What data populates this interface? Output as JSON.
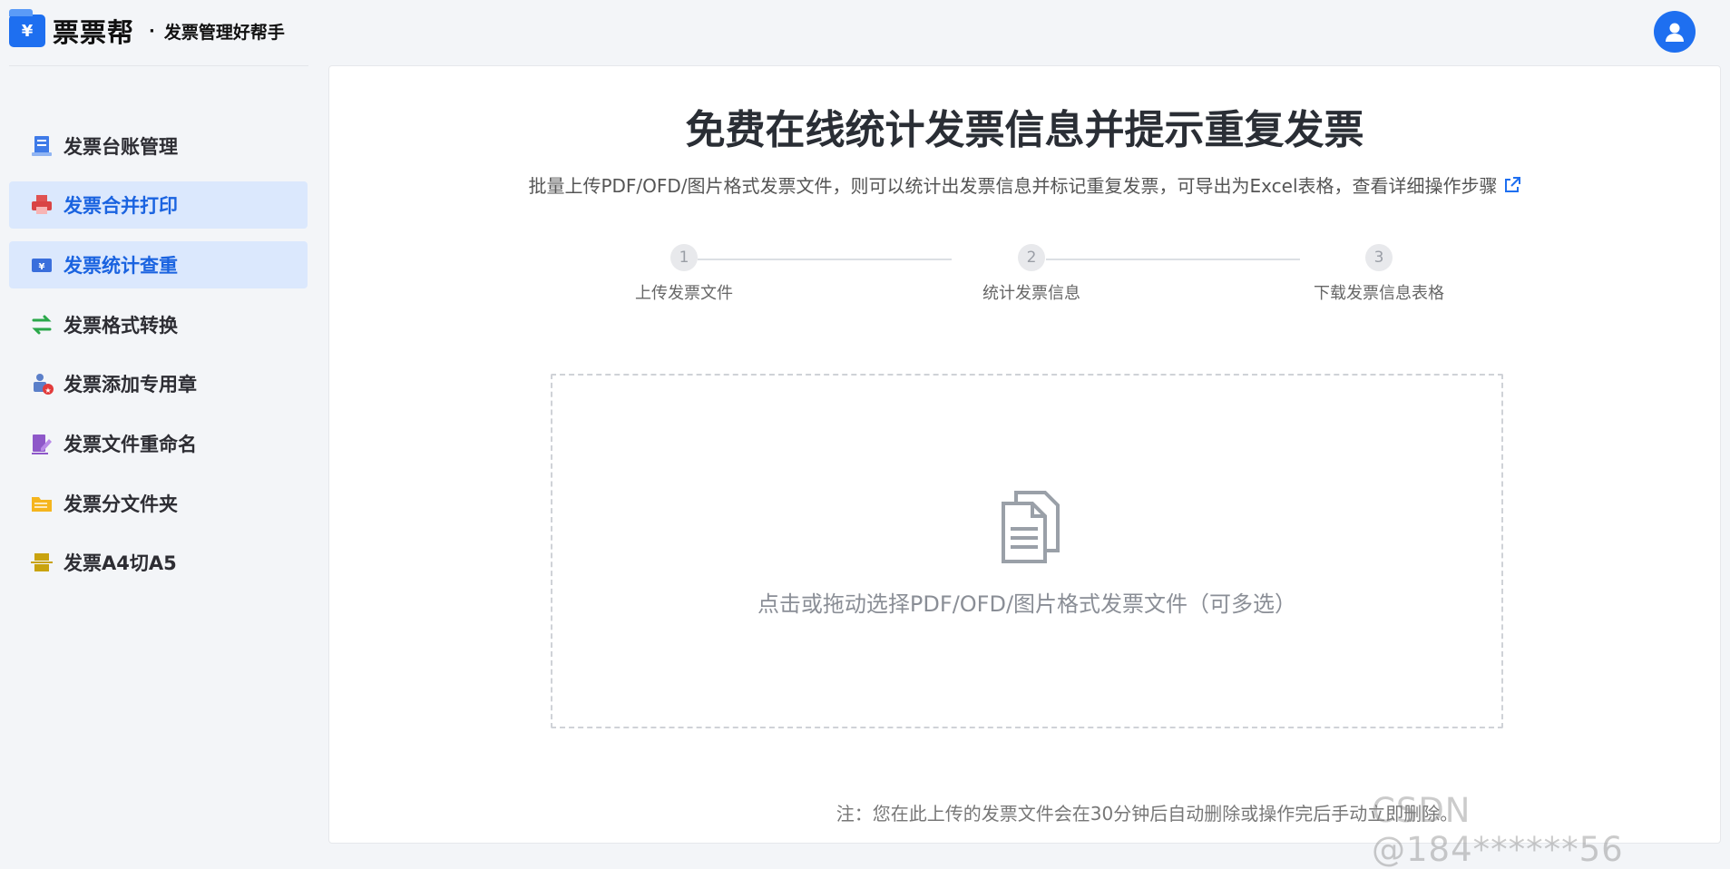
{
  "header": {
    "brand_mark": "¥",
    "brand_name": "票票帮",
    "separator": "·",
    "tagline": "发票管理好帮手"
  },
  "sidebar": {
    "items": [
      {
        "label": "发票台账管理",
        "icon": "ledger-icon",
        "active": false
      },
      {
        "label": "发票合并打印",
        "icon": "printer-icon",
        "active": true
      },
      {
        "label": "发票统计查重",
        "icon": "statistics-icon",
        "active": true
      },
      {
        "label": "发票格式转换",
        "icon": "convert-arrows-icon",
        "active": false
      },
      {
        "label": "发票添加专用章",
        "icon": "stamp-icon",
        "active": false
      },
      {
        "label": "发票文件重命名",
        "icon": "rename-edit-icon",
        "active": false
      },
      {
        "label": "发票分文件夹",
        "icon": "folder-icon",
        "active": false
      },
      {
        "label": "发票A4切A5",
        "icon": "cut-icon",
        "active": false
      }
    ]
  },
  "main": {
    "title": "免费在线统计发票信息并提示重复发票",
    "subtitle": "批量上传PDF/OFD/图片格式发票文件，则可以统计出发票信息并标记重复发票，可导出为Excel表格，查看详细操作步骤",
    "steps": [
      {
        "number": "1",
        "label": "上传发票文件"
      },
      {
        "number": "2",
        "label": "统计发票信息"
      },
      {
        "number": "3",
        "label": "下载发票信息表格"
      }
    ],
    "dropzone_text": "点击或拖动选择PDF/OFD/图片格式发票文件（可多选）",
    "note": "注：您在此上传的发票文件会在30分钟后自动删除或操作完后手动立即删除。"
  },
  "watermark": "CSDN @184******56",
  "colors": {
    "accent": "#1e6ff0",
    "active_bg": "#dbe8fd",
    "active_text": "#1a63e0"
  }
}
